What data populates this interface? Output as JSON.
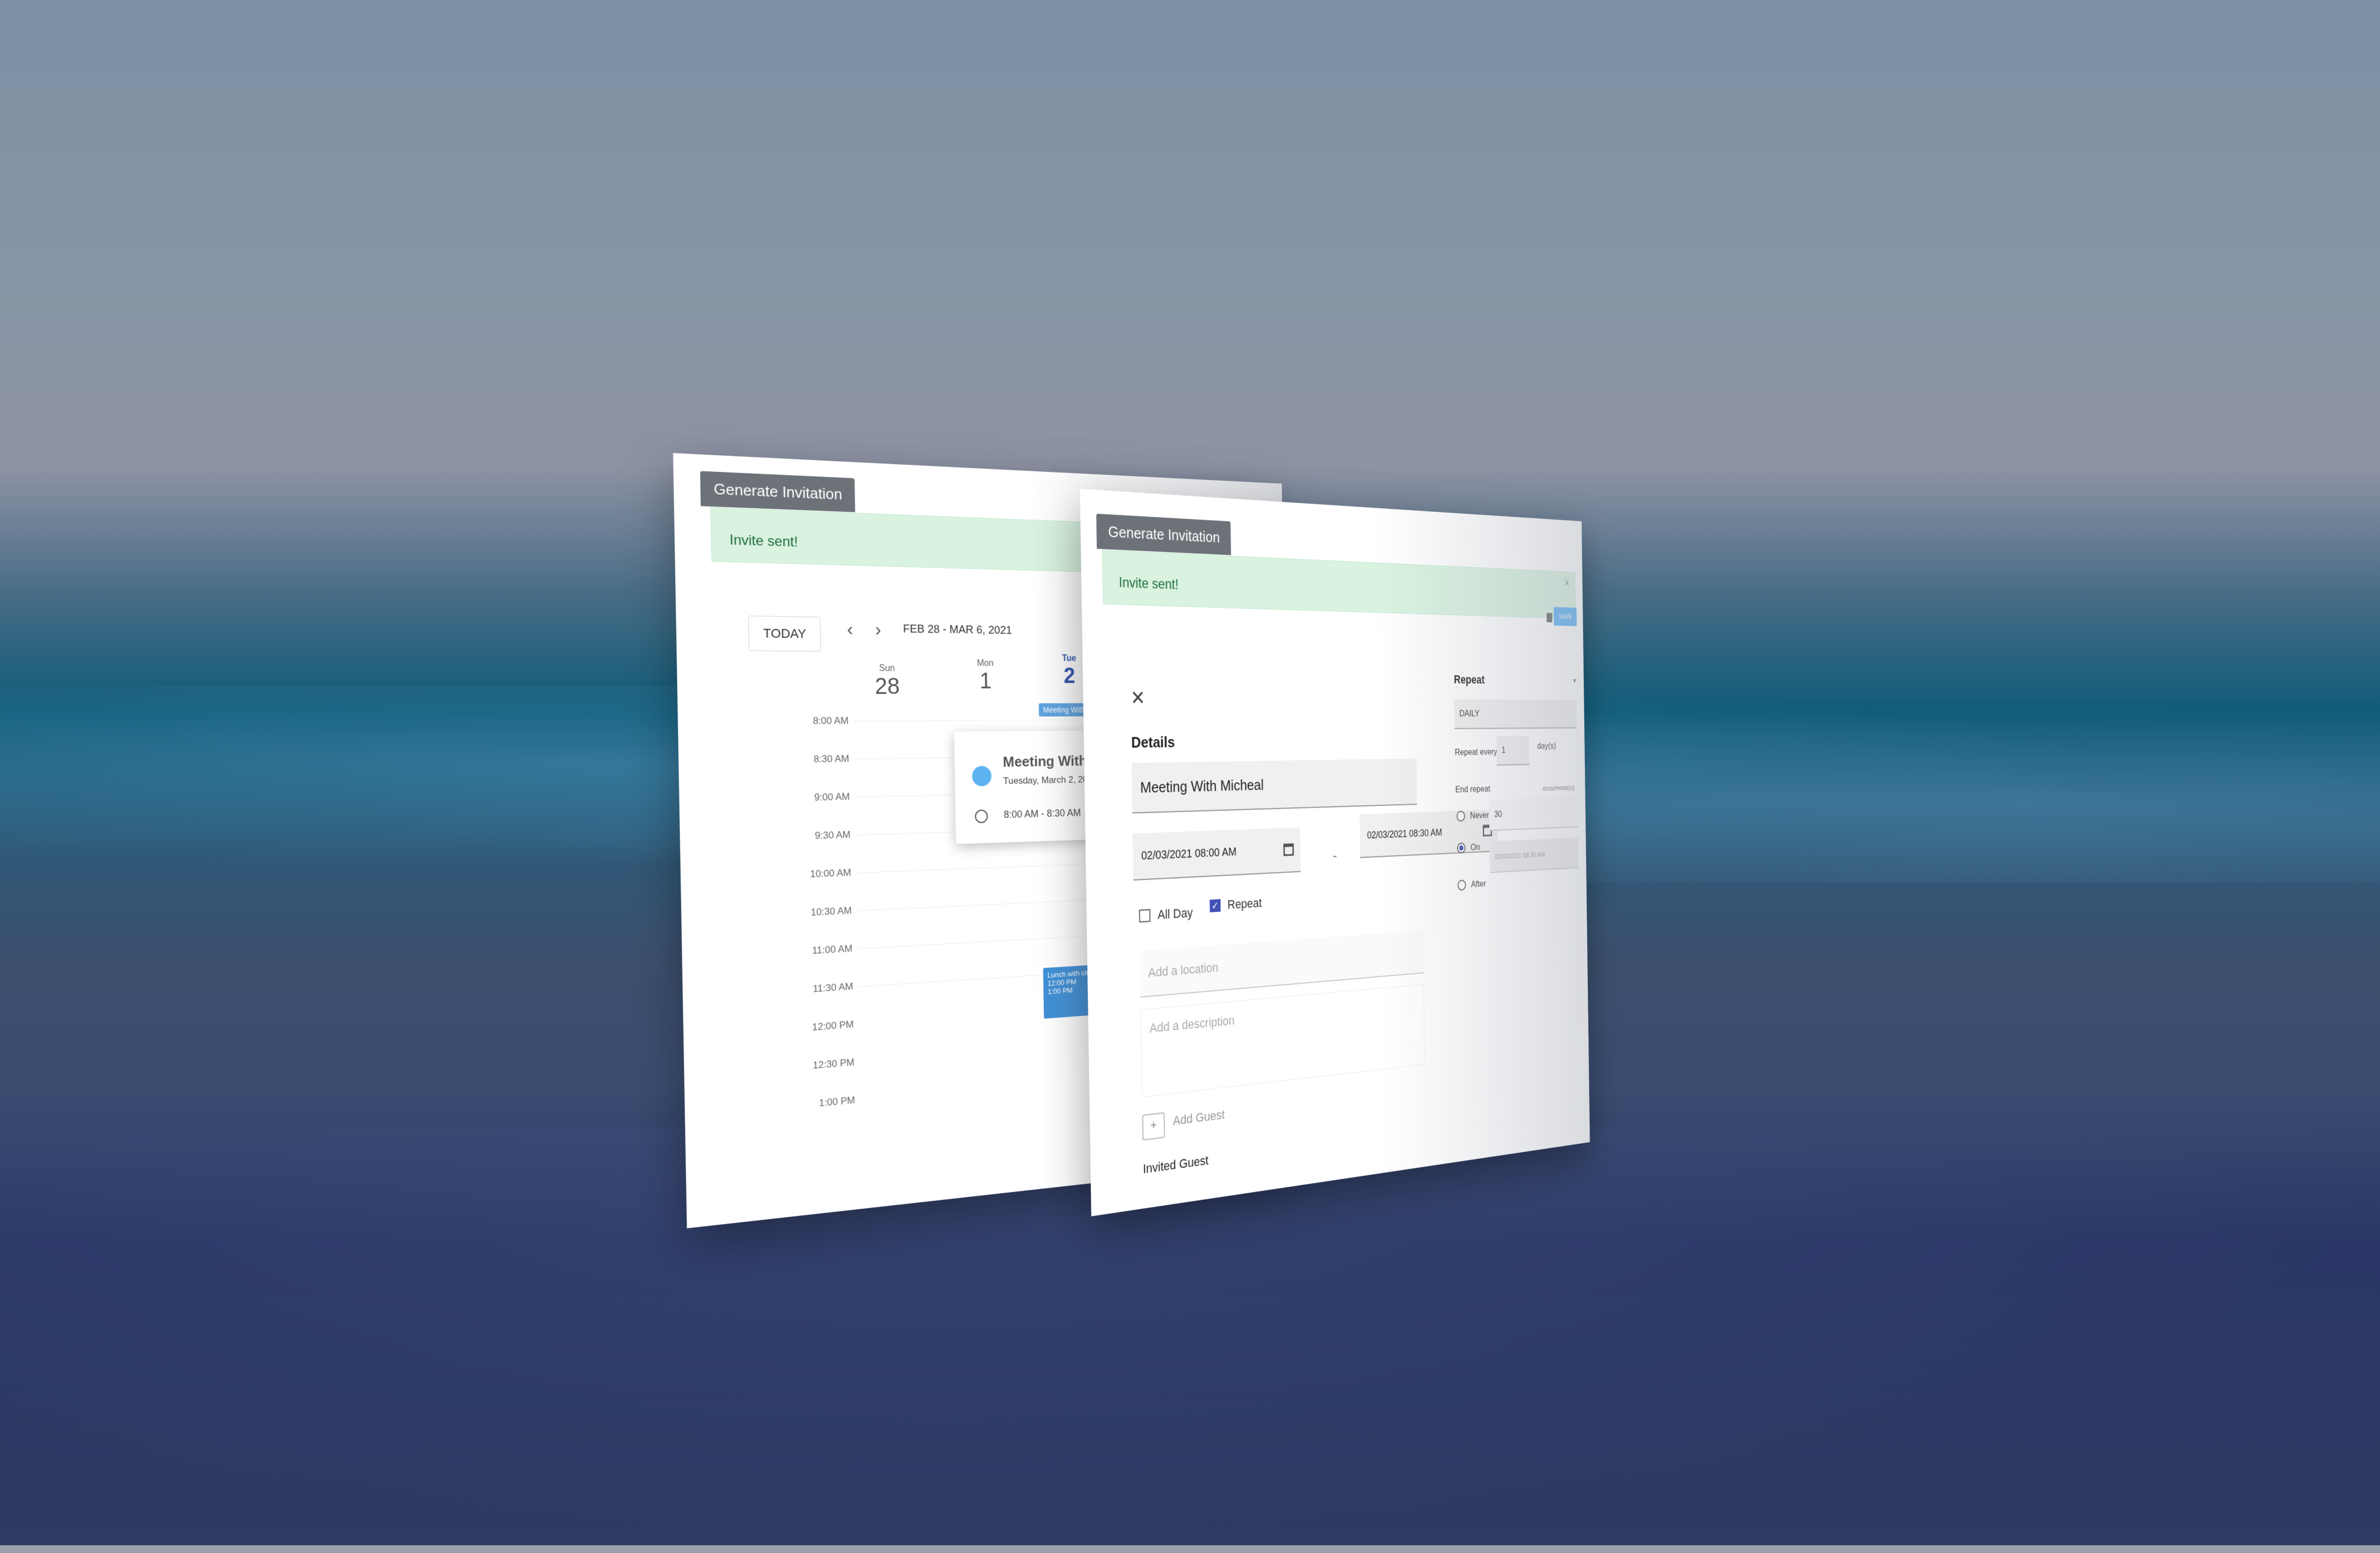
{
  "back_window": {
    "generate_button": "Generate Invitation",
    "alert": {
      "message": "Invite sent!",
      "close": "x"
    },
    "toolbar": {
      "today_label": "TODAY",
      "prev_icon": "chevron-left-icon",
      "next_icon": "chevron-right-icon",
      "range": "FEB 28 - MAR 6, 2021"
    },
    "days": [
      {
        "dow": "Sun",
        "num": "28"
      },
      {
        "dow": "Mon",
        "num": "1"
      },
      {
        "dow": "Tue",
        "num": "2"
      }
    ],
    "times": [
      "8:00 AM",
      "8:30 AM",
      "9:00 AM",
      "9:30 AM",
      "10:00 AM",
      "10:30 AM",
      "11:00 AM",
      "11:30 AM",
      "12:00 PM",
      "12:30 PM",
      "1:00 PM"
    ],
    "allday_event": "Meeting With Mic...",
    "popup": {
      "title": "Meeting With Mic",
      "date": "Tuesday, March 2, 2021",
      "time": "8:00 AM - 8:30 AM"
    },
    "lunch_event": {
      "title": "Lunch with client",
      "line2": "12:00 PM",
      "line3": "1:00 PM"
    }
  },
  "front_window": {
    "generate_button": "Generate Invitation",
    "alert": {
      "message": "Invite sent!",
      "close": "x"
    },
    "save_label": "SAVE",
    "details_label": "Details",
    "title_value": "Meeting With Micheal",
    "start_value": "02/03/2021 08:00 AM",
    "end_value": "02/03/2021 08:30 AM",
    "dash": "-",
    "all_day_label": "All Day",
    "repeat_label": "Repeat",
    "location_placeholder": "Add a location",
    "description_placeholder": "Add a description",
    "add_guest_symbol": "+",
    "add_guest_label": "Add Guest",
    "invited_guest_label": "Invited Guest",
    "repeat_panel": {
      "title": "Repeat",
      "frequency": "DAILY",
      "repeat_every_label": "Repeat every",
      "repeat_every_value": "1",
      "unit": "day(s)",
      "end_repeat_label": "End repeat",
      "never_label": "Never",
      "on_label": "On",
      "after_label": "After",
      "occurrences_value": "30",
      "occurrences_suffix": "occurrence(s)",
      "date_value": "02/03/2021 08:30 AM"
    }
  }
}
